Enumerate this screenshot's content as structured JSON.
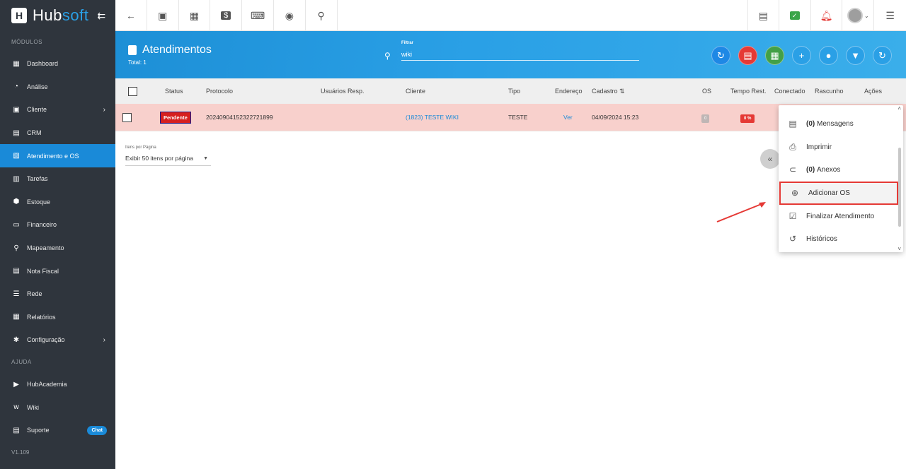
{
  "app": {
    "logo_text_a": "Hub",
    "logo_text_b": "soft"
  },
  "sidebar": {
    "section_modulos": "MÓDULOS",
    "section_ajuda": "AJUDA",
    "items": [
      {
        "label": "Dashboard",
        "icon": "dashboard-icon"
      },
      {
        "label": "Análise",
        "icon": "chart-icon"
      },
      {
        "label": "Cliente",
        "icon": "client-icon"
      },
      {
        "label": "CRM",
        "icon": "crm-icon"
      },
      {
        "label": "Atendimento e OS",
        "icon": "support-icon"
      },
      {
        "label": "Tarefas",
        "icon": "tasks-icon"
      },
      {
        "label": "Estoque",
        "icon": "box-icon"
      },
      {
        "label": "Financeiro",
        "icon": "money-icon"
      },
      {
        "label": "Mapeamento",
        "icon": "map-icon"
      },
      {
        "label": "Nota Fiscal",
        "icon": "invoice-icon"
      },
      {
        "label": "Rede",
        "icon": "network-icon"
      },
      {
        "label": "Relatórios",
        "icon": "reports-icon"
      },
      {
        "label": "Configuração",
        "icon": "gear-icon"
      }
    ],
    "help_items": [
      {
        "label": "HubAcademia",
        "icon": "video-icon"
      },
      {
        "label": "Wiki",
        "icon": "wiki-icon"
      },
      {
        "label": "Suporte",
        "icon": "support-doc-icon",
        "badge": "Chat"
      }
    ],
    "version": "V1.109"
  },
  "header": {
    "title": "Atendimentos",
    "total": "Total: 1",
    "filter_label": "Filtrar",
    "filter_value": "wiki"
  },
  "table": {
    "headers": [
      "Status",
      "Protocolo",
      "Usuários Resp.",
      "Cliente",
      "Tipo",
      "Endereço",
      "Cadastro",
      "OS",
      "Tempo Rest.",
      "Conectado",
      "Rascunho",
      "Ações"
    ],
    "row": {
      "status": "Pendente",
      "protocolo": "20240904152322721899",
      "cliente": "(1823) TESTE WIKI",
      "tipo": "TESTE",
      "endereco": "Ver",
      "cadastro": "04/09/2024 15:23",
      "os": "0",
      "tempo": "0 %"
    }
  },
  "pagination": {
    "label": "Itens por Página",
    "selected": "Exibir 50 itens por página"
  },
  "menu": {
    "items": [
      {
        "count": "(0)",
        "label": "Mensagens",
        "icon": "message-icon"
      },
      {
        "label": "Imprimir",
        "icon": "print-icon"
      },
      {
        "count": "(0)",
        "label": "Anexos",
        "icon": "attachment-icon"
      },
      {
        "label": "Adicionar OS",
        "icon": "add-circle-icon"
      },
      {
        "label": "Finalizar Atendimento",
        "icon": "calendar-check-icon"
      },
      {
        "label": "Históricos",
        "icon": "history-icon"
      }
    ]
  },
  "colors": {
    "sidebar_bg": "#2f353d",
    "accent": "#1a8ad8",
    "row_highlight": "#f8d0cc",
    "danger": "#e53935"
  }
}
